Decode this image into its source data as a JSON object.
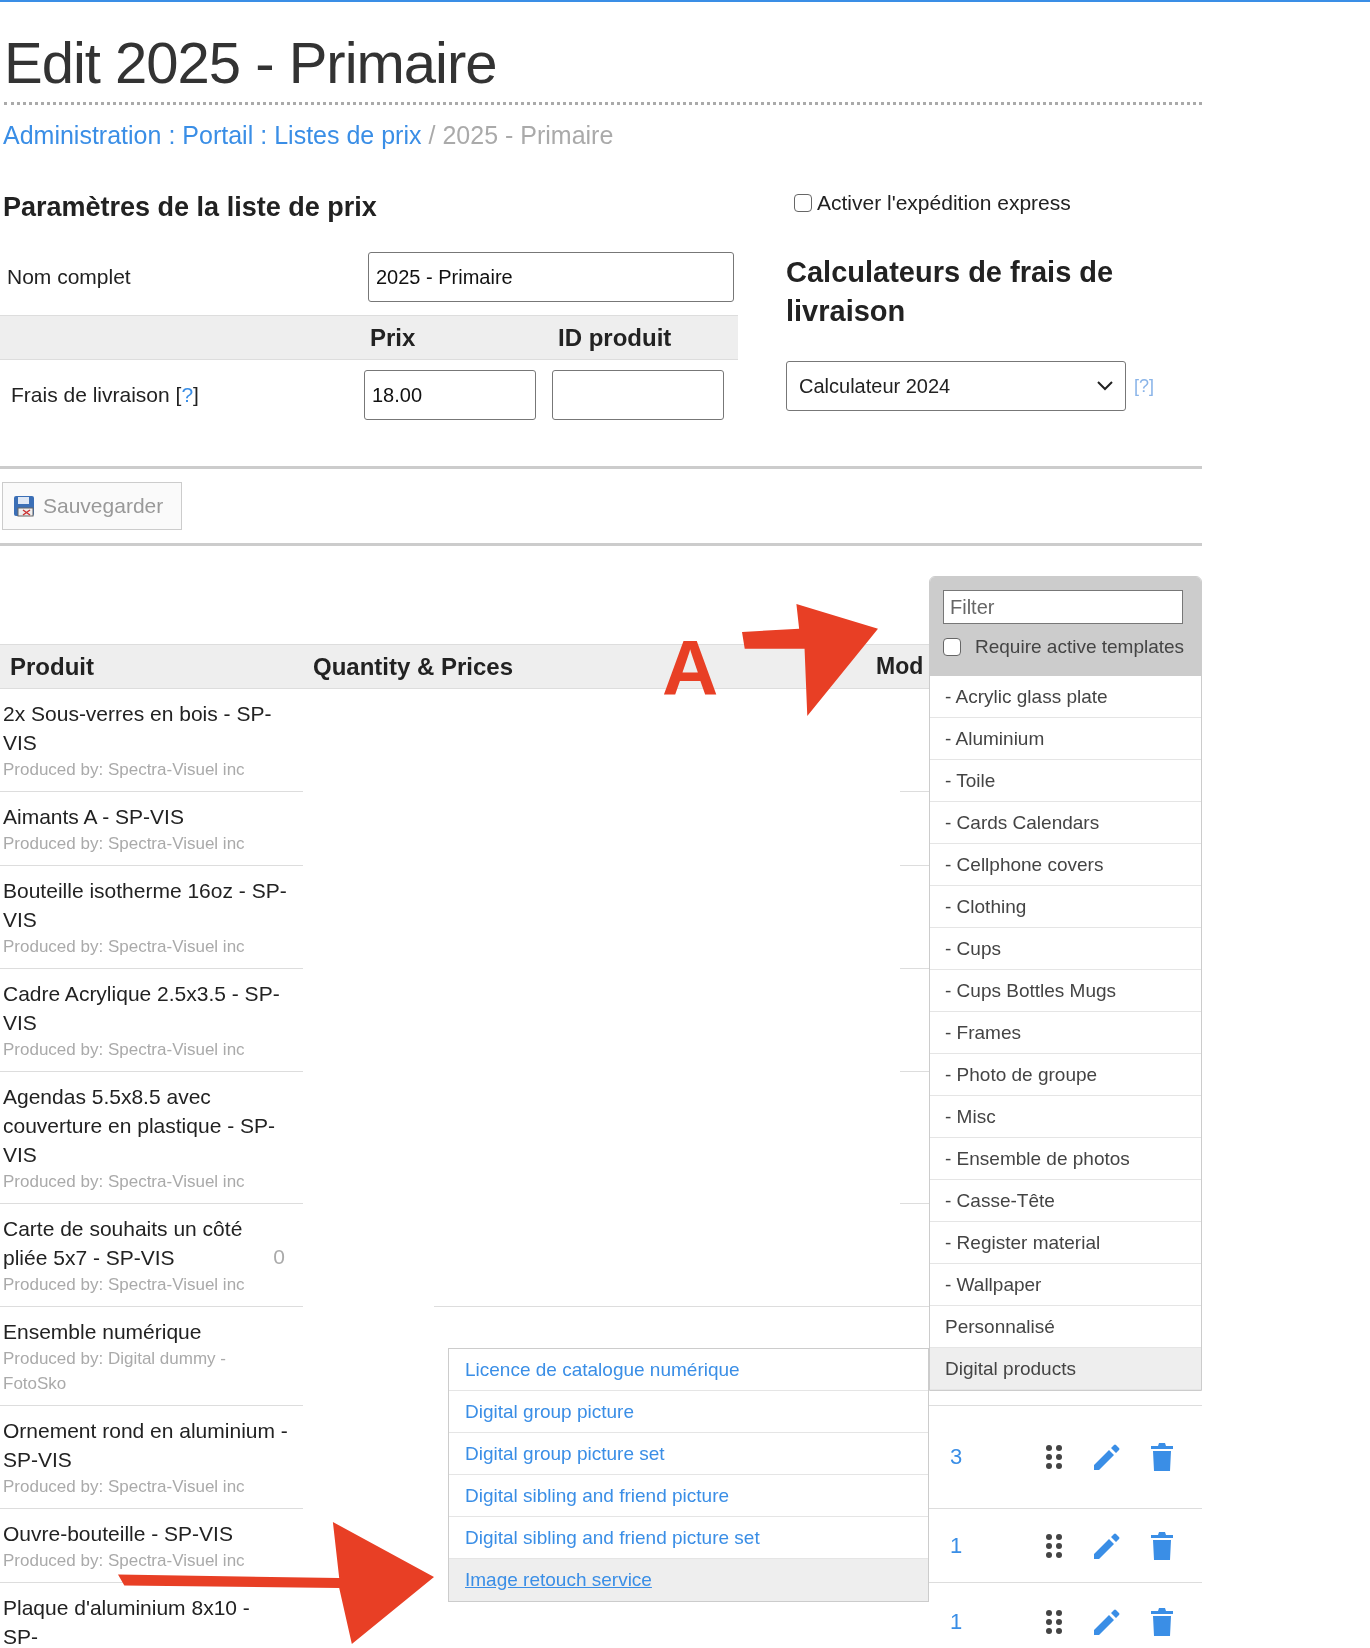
{
  "page_title": "Edit 2025 - Primaire",
  "breadcrumb": [
    {
      "text": "Administration",
      "kind": "link"
    },
    {
      "text": ":",
      "kind": "link-separator"
    },
    {
      "text": "Portail",
      "kind": "link"
    },
    {
      "text": ":",
      "kind": "link-separator"
    },
    {
      "text": "Listes de prix",
      "kind": "link"
    },
    {
      "text": "/",
      "kind": "separator"
    },
    {
      "text": "2025 - Primaire",
      "kind": "current"
    }
  ],
  "settings": {
    "title": "Paramètres de la liste de prix",
    "express_shipping": {
      "label": "Activer l'expédition express",
      "checked": false
    },
    "full_name": {
      "label": "Nom complet",
      "value": "2025 - Primaire"
    },
    "columns": [
      "Prix",
      "ID produit"
    ],
    "shipping_fee": {
      "label": "Frais de livraison",
      "help": {
        "open": "[",
        "mark": "?",
        "close": "]"
      },
      "price": "18.00"
    },
    "calculators": {
      "title": "Calculateurs de frais de livraison",
      "value": "Calculateur 2024",
      "help": "[?]"
    }
  },
  "save_button": {
    "label": "Sauvegarder",
    "disabled": true
  },
  "table": {
    "columns": [
      "Produit",
      "Quantity & Prices",
      "Mod"
    ],
    "rows": [
      {
        "name": "2x Sous-verres en bois - SP-VIS",
        "producer": "Produced by: Spectra-Visuel inc"
      },
      {
        "name": "Aimants A - SP-VIS",
        "producer": "Produced by: Spectra-Visuel inc"
      },
      {
        "name": "Bouteille isotherme 16oz - SP-VIS",
        "producer": "Produced by: Spectra-Visuel inc"
      },
      {
        "name": "Cadre Acrylique 2.5x3.5 - SP-VIS",
        "producer": "Produced by: Spectra-Visuel inc"
      },
      {
        "name": "Agendas 5.5x8.5 avec couverture en plastique - SP-VIS",
        "producer": "Produced by: Spectra-Visuel inc"
      },
      {
        "name": "Carte de souhaits un côté pliée 5x7 - SP-VIS",
        "producer": "Produced by: Spectra-Visuel inc",
        "quantity": "0"
      },
      {
        "name": "Ensemble numérique",
        "producer": "Produced by: Digital dummy - FotoSko"
      },
      {
        "name": "Ornement rond en aluminium - SP-VIS",
        "producer": "Produced by: Spectra-Visuel inc",
        "count": "3"
      },
      {
        "name": "Ouvre-bouteille - SP-VIS",
        "producer": "Produced by: Spectra-Visuel inc",
        "count": "1"
      },
      {
        "name": "Plaque d'aluminium 8x10 - SP-",
        "count": "1"
      }
    ]
  },
  "template_panel": {
    "filter_placeholder": "Filter",
    "require_active": {
      "label": "Require active templates",
      "checked": false
    },
    "items": [
      {
        "label": "- Acrylic glass plate",
        "selected": false
      },
      {
        "label": "- Aluminium",
        "selected": false
      },
      {
        "label": "- Toile",
        "selected": false
      },
      {
        "label": "- Cards Calendars",
        "selected": false
      },
      {
        "label": "- Cellphone covers",
        "selected": false
      },
      {
        "label": "- Clothing",
        "selected": false
      },
      {
        "label": "- Cups",
        "selected": false
      },
      {
        "label": "- Cups Bottles Mugs",
        "selected": false
      },
      {
        "label": "- Frames",
        "selected": false
      },
      {
        "label": "- Photo de groupe",
        "selected": false
      },
      {
        "label": "- Misc",
        "selected": false
      },
      {
        "label": "- Ensemble de photos",
        "selected": false
      },
      {
        "label": "- Casse-Tête",
        "selected": false
      },
      {
        "label": "- Register material",
        "selected": false
      },
      {
        "label": "- Wallpaper",
        "selected": false
      },
      {
        "label": "Personnalisé",
        "selected": false
      },
      {
        "label": "Digital products",
        "selected": true
      }
    ]
  },
  "submenu": {
    "items": [
      {
        "label": "Licence de catalogue numérique",
        "selected": false
      },
      {
        "label": "Digital group picture",
        "selected": false
      },
      {
        "label": "Digital group picture set",
        "selected": false
      },
      {
        "label": "Digital sibling and friend picture",
        "selected": false
      },
      {
        "label": "Digital sibling and friend picture set",
        "selected": false
      },
      {
        "label": "Image retouch service",
        "selected": true
      }
    ]
  },
  "annotations": [
    {
      "kind": "label",
      "text": "A"
    },
    {
      "kind": "arrow"
    },
    {
      "kind": "arrow"
    }
  ]
}
